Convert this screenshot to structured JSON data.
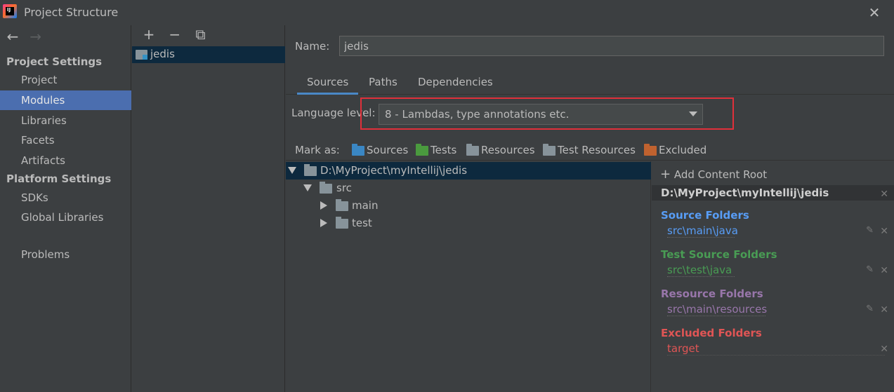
{
  "window": {
    "title": "Project Structure",
    "close": "✕"
  },
  "nav": {
    "back": "←",
    "forward": "→",
    "project_settings_header": "Project Settings",
    "platform_settings_header": "Platform Settings",
    "items": [
      {
        "label": "Project"
      },
      {
        "label": "Modules",
        "selected": true
      },
      {
        "label": "Libraries"
      },
      {
        "label": "Facets"
      },
      {
        "label": "Artifacts"
      },
      {
        "label": "SDKs"
      },
      {
        "label": "Global Libraries"
      },
      {
        "label": "Problems"
      }
    ]
  },
  "modules": {
    "toolbar": {
      "add": "+",
      "remove": "−",
      "copy": "⧉"
    },
    "list": [
      "jedis"
    ]
  },
  "module": {
    "name_label": "Name:",
    "name_value": "jedis",
    "tabs": [
      "Sources",
      "Paths",
      "Dependencies"
    ],
    "active_tab": "Sources",
    "language_level_label": "Language level:",
    "language_level_value": "8 - Lambdas, type annotations etc.",
    "mark_as_label": "Mark as:",
    "mark_as": [
      {
        "label": "Sources",
        "color": "#3a87c4"
      },
      {
        "label": "Tests",
        "color": "#4a9a3e"
      },
      {
        "label": "Resources",
        "color": "#87939a"
      },
      {
        "label": "Test Resources",
        "color": "#87939a"
      },
      {
        "label": "Excluded",
        "color": "#c0622f"
      }
    ]
  },
  "tree": {
    "root": "D:\\MyProject\\myIntellij\\jedis",
    "src": "src",
    "main": "main",
    "test": "test"
  },
  "content_root": {
    "add_label": "Add Content Root",
    "path": "D:\\MyProject\\myIntellij\\jedis",
    "source_title": "Source Folders",
    "source_path": "src\\main\\java",
    "test_title": "Test Source Folders",
    "test_path": "src\\test\\java",
    "resource_title": "Resource Folders",
    "resource_path": "src\\main\\resources",
    "excluded_title": "Excluded Folders",
    "excluded_path": "target",
    "colors": {
      "source": "#589df6",
      "test": "#499c54",
      "resource": "#9876aa",
      "excluded": "#e05555"
    }
  }
}
